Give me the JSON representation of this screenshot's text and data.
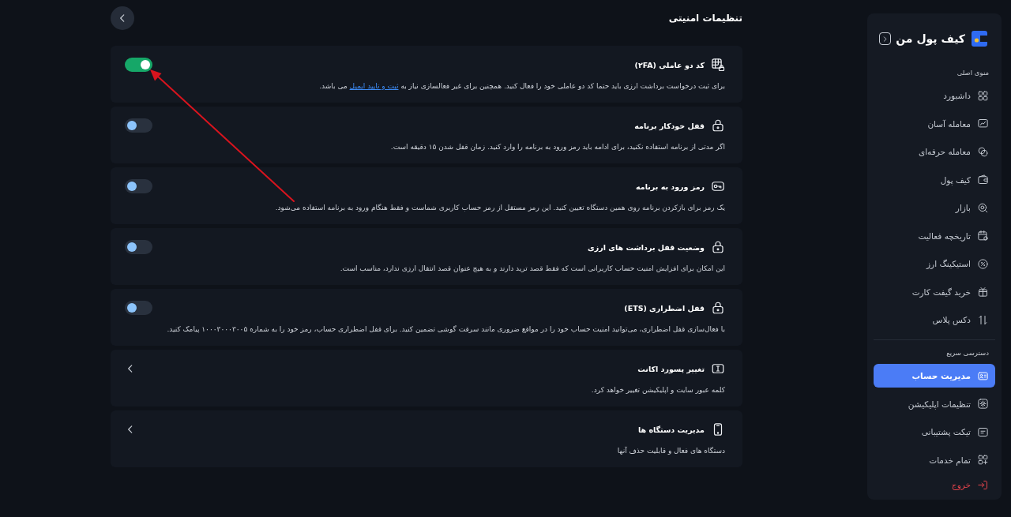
{
  "sidebar": {
    "logo": "کیف پول من",
    "sections": [
      {
        "label": "منوی اصلی",
        "items": [
          {
            "label": "داشبورد",
            "selected": false,
            "kind": "nav"
          },
          {
            "label": "معامله آسان",
            "selected": false,
            "kind": "nav"
          },
          {
            "label": "معامله حرفه‌ای",
            "selected": false,
            "kind": "nav"
          },
          {
            "label": "کیف پول",
            "selected": false,
            "kind": "nav"
          },
          {
            "label": "بازار",
            "selected": false,
            "kind": "nav"
          },
          {
            "label": "تاریخچه فعالیت",
            "selected": false,
            "kind": "nav"
          },
          {
            "label": "استیکینگ ارز",
            "selected": false,
            "kind": "nav"
          },
          {
            "label": "خرید گیفت کارت",
            "selected": false,
            "kind": "nav"
          },
          {
            "label": "دکس پلاس",
            "selected": false,
            "kind": "nav"
          }
        ]
      },
      {
        "label": "دسترسی سریع",
        "items": [
          {
            "label": "مدیریت حساب",
            "selected": true,
            "kind": "nav"
          },
          {
            "label": "تنظیمات اپلیکیشن",
            "selected": false,
            "kind": "nav"
          },
          {
            "label": "تیکت پشتیبانی",
            "selected": false,
            "kind": "nav"
          },
          {
            "label": "تمام خدمات",
            "selected": false,
            "kind": "nav"
          },
          {
            "label": "خروج",
            "selected": false,
            "kind": "exit"
          }
        ]
      }
    ]
  },
  "header": {
    "title": "تنظیمات امنیتی"
  },
  "cards": [
    {
      "kind": "toggle",
      "title": "کد دو عاملی (۲FA)",
      "description": "برای ثبت درخواست برداشت ارزی باید حتما کد دو عاملی خود را فعال کنید. همچنین برای غیر فعالسازی نیاز به ",
      "link": "ثبت و تایید ایمیل",
      "description_end": " می باشد.",
      "on": true
    },
    {
      "kind": "toggle",
      "title": "قفل خودکار برنامه",
      "description": "اگر مدتی از برنامه استفاده نکنید، برای ادامه باید رمز ورود به برنامه را وارد کنید. زمان قفل شدن ۱۵ دقیقه است.",
      "on": false
    },
    {
      "kind": "toggle",
      "title": "رمز ورود به برنامه",
      "description": "یک رمز برای بازکردن برنامه روی همین دستگاه تعیین کنید. این رمز مستقل از رمز حساب کاربری شماست و فقط هنگام ورود به برنامه استفاده می‌شود.",
      "on": false
    },
    {
      "kind": "toggle",
      "title": "وضعیت قفل برداشت های ارزی",
      "description": "این امکان برای افزایش امنیت حساب کاربرانی است که فقط قصد ترید دارند و به هیچ عنوان قصد انتقال ارزی ندارد، مناسب است.",
      "on": false
    },
    {
      "kind": "toggle",
      "title": "قفل اضطراری (ETS)",
      "description": "با فعال‌سازی قفل اضطراری، می‌توانید امنیت حساب خود را در مواقع ضروری مانند سرقت گوشی تضمین کنید. برای قفل اضطراری حساب، رمز خود را به شماره ۱۰۰۰۳۰۰۰۳۰۰۵ پیامک کنید.",
      "on": false
    },
    {
      "kind": "link",
      "title": "تغییر پسورد اکانت",
      "description": "کلمه عبور سایت و اپلیکیشن تغییر خواهد کرد."
    },
    {
      "kind": "link",
      "title": "مدیریت دستگاه ها",
      "description": "دستگاه های فعال و قابلیت حذف آنها"
    }
  ],
  "annotations": [
    {
      "kind": "arrow"
    }
  ]
}
